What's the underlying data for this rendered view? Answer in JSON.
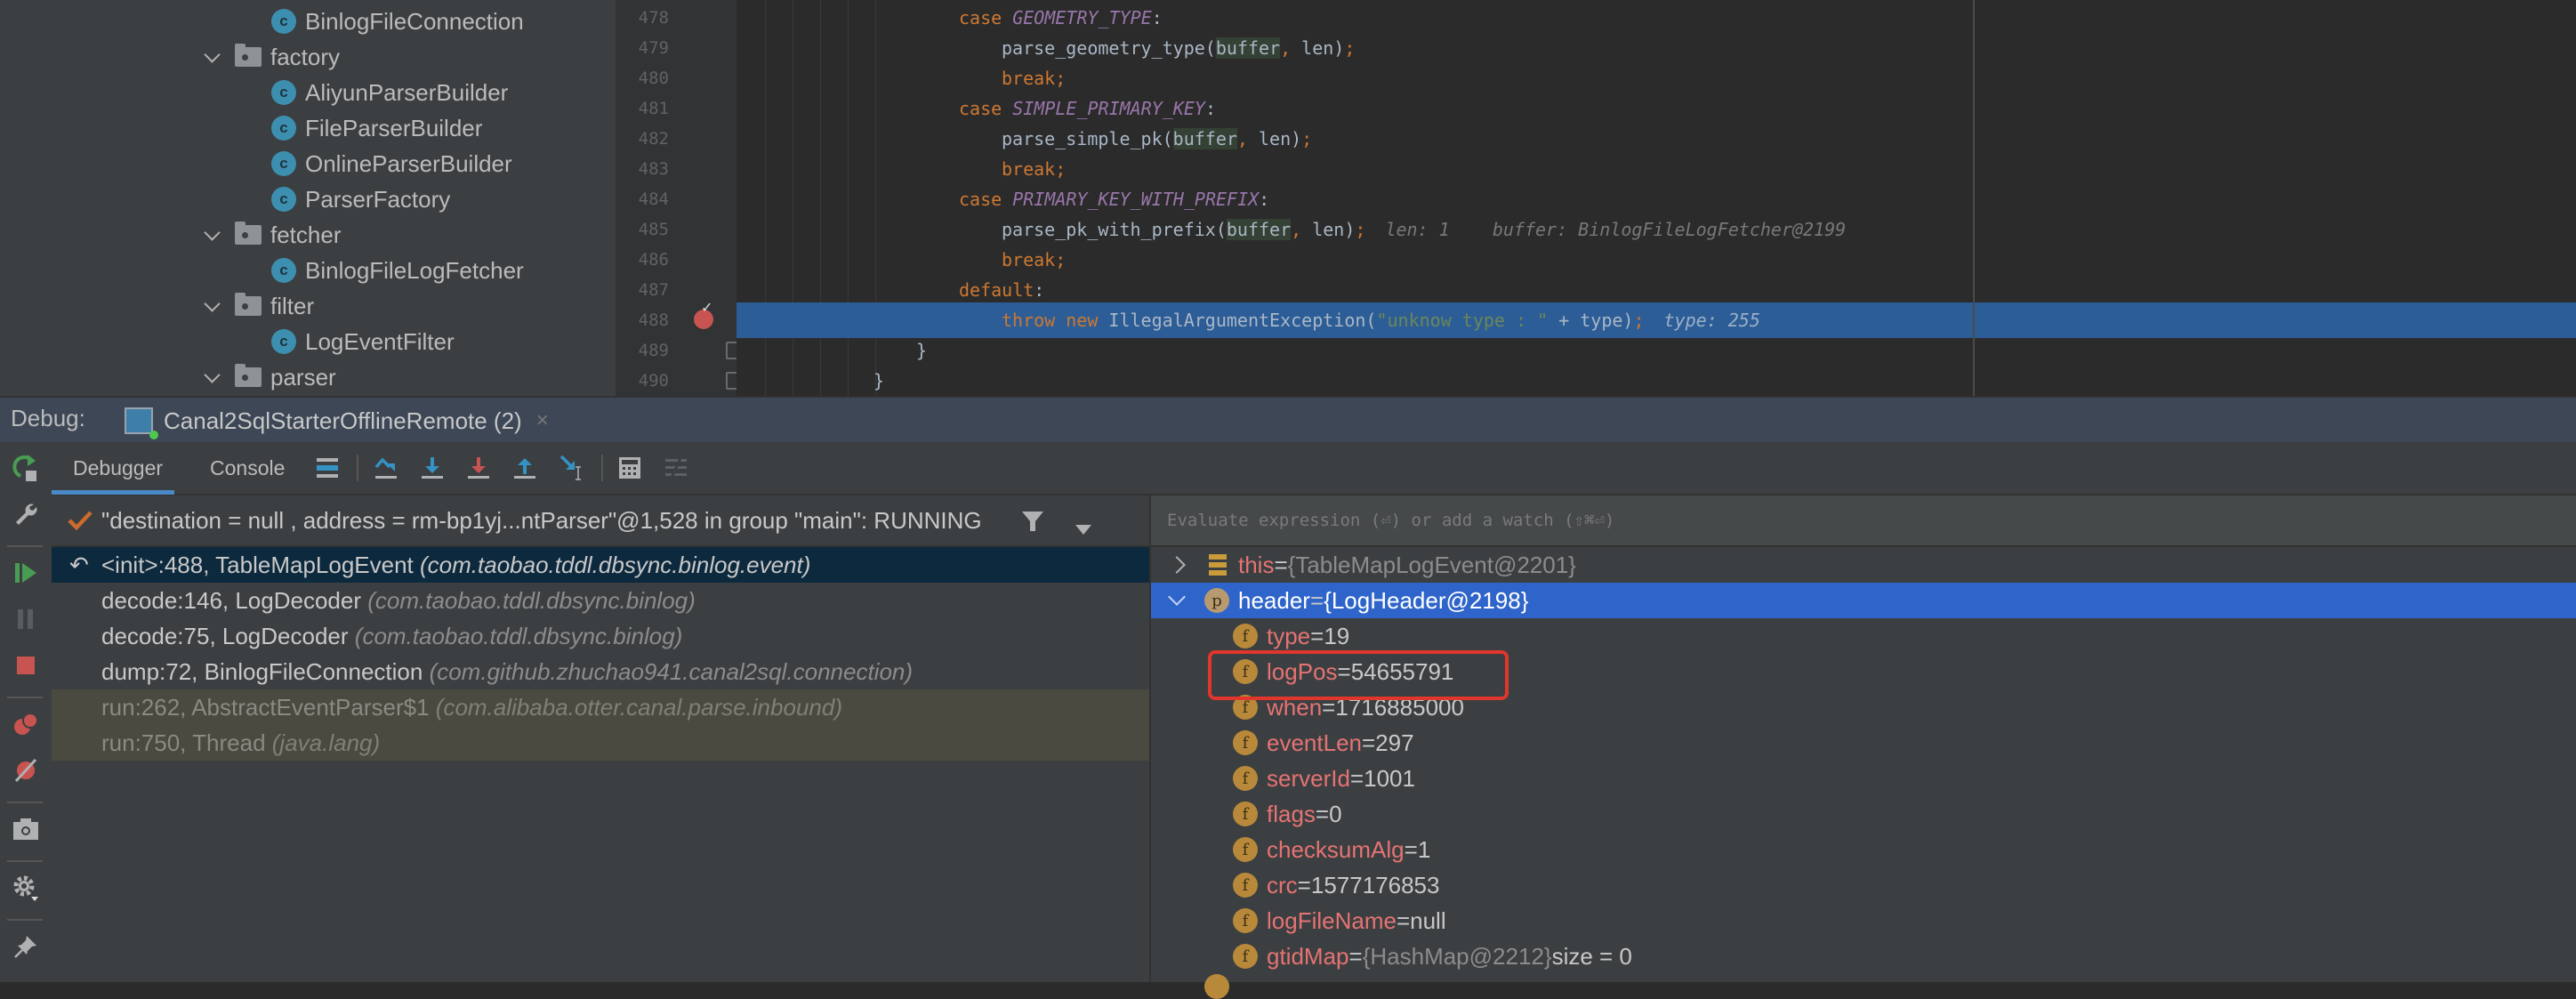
{
  "project_tree": {
    "items": [
      {
        "type": "class",
        "label": "BinlogFileConnection",
        "level": 2
      },
      {
        "type": "folder",
        "label": "factory",
        "level": 1,
        "expanded": true
      },
      {
        "type": "class",
        "label": "AliyunParserBuilder",
        "level": 2
      },
      {
        "type": "class",
        "label": "FileParserBuilder",
        "level": 2
      },
      {
        "type": "class",
        "label": "OnlineParserBuilder",
        "level": 2
      },
      {
        "type": "class",
        "label": "ParserFactory",
        "level": 2
      },
      {
        "type": "folder",
        "label": "fetcher",
        "level": 1,
        "expanded": true
      },
      {
        "type": "class",
        "label": "BinlogFileLogFetcher",
        "level": 2
      },
      {
        "type": "folder",
        "label": "filter",
        "level": 1,
        "expanded": true
      },
      {
        "type": "class",
        "label": "LogEventFilter",
        "level": 2
      },
      {
        "type": "folder",
        "label": "parser",
        "level": 1,
        "expanded": true
      }
    ],
    "class_icon_letter": "c"
  },
  "editor": {
    "line_numbers": [
      "478",
      "479",
      "480",
      "481",
      "482",
      "483",
      "484",
      "485",
      "486",
      "487",
      "488",
      "489",
      "490"
    ],
    "execution_line": "488",
    "breakpoint_line": "488",
    "lines": {
      "l478": {
        "kw": "case ",
        "const": "GEOMETRY_TYPE",
        "rest": ":"
      },
      "l479": {
        "fn": "parse_geometry_type(",
        "arg": "buffer",
        "comma": ", ",
        "rest": "len)",
        "semi": ";"
      },
      "l480": {
        "kw": "break;"
      },
      "l481": {
        "kw": "case ",
        "const": "SIMPLE_PRIMARY_KEY",
        "rest": ":"
      },
      "l482": {
        "fn": "parse_simple_pk(",
        "arg": "buffer",
        "comma": ", ",
        "rest": "len)",
        "semi": ";"
      },
      "l483": {
        "kw": "break;"
      },
      "l484": {
        "kw": "case ",
        "const": "PRIMARY_KEY_WITH_PREFIX",
        "rest": ":"
      },
      "l485": {
        "fn": "parse_pk_with_prefix(",
        "arg": "buffer",
        "comma": ", ",
        "rest": "len)",
        "semi": ";",
        "hint": "len: 1    buffer: BinlogFileLogFetcher@2199"
      },
      "l486": {
        "kw": "break;"
      },
      "l487": {
        "kw": "default",
        "rest": ":"
      },
      "l488": {
        "kw": "throw new ",
        "fn": "IllegalArgumentException(",
        "str": "\"unknow type : \"",
        "rest": " + type)",
        "semi": ";",
        "hint": "type: 255"
      },
      "l489": {
        "rest": "}"
      },
      "l490": {
        "rest": "}"
      }
    }
  },
  "debug": {
    "label": "Debug:",
    "session_tab": "Canal2SqlStarterOfflineRemote (2)",
    "session_close": "×",
    "tabs": [
      {
        "label": "Debugger",
        "active": true
      },
      {
        "label": "Console",
        "active": false
      }
    ],
    "toolbar_icons": [
      "show-execution-point-icon",
      "step-over-icon",
      "step-into-icon",
      "force-step-into-icon",
      "step-out-icon",
      "run-to-cursor-icon",
      "evaluate-expression-icon",
      "trace-current-stream-icon"
    ],
    "side_icons": [
      "rerun-icon",
      "settings-wrench-icon",
      "resume-icon",
      "pause-icon",
      "stop-icon",
      "view-breakpoints-icon",
      "mute-breakpoints-icon",
      "camera-icon",
      "gear-icon",
      "pin-icon"
    ]
  },
  "frames": {
    "thread": "\"destination = null , address = rm-bp1yj...ntParser\"@1,528 in group \"main\": RUNNING",
    "items": [
      {
        "method": "<init>:488, TableMapLogEvent ",
        "pkg": "(com.taobao.tddl.dbsync.binlog.event)",
        "state": "selected"
      },
      {
        "method": "decode:146, LogDecoder ",
        "pkg": "(com.taobao.tddl.dbsync.binlog)",
        "state": "normal"
      },
      {
        "method": "decode:75, LogDecoder ",
        "pkg": "(com.taobao.tddl.dbsync.binlog)",
        "state": "normal"
      },
      {
        "method": "dump:72, BinlogFileConnection ",
        "pkg": "(com.github.zhuchao941.canal2sql.connection)",
        "state": "normal"
      },
      {
        "method": "run:262, AbstractEventParser$1 ",
        "pkg": "(com.alibaba.otter.canal.parse.inbound)",
        "state": "library"
      },
      {
        "method": "run:750, Thread ",
        "pkg": "(java.lang)",
        "state": "library"
      }
    ]
  },
  "variables": {
    "eval_placeholder": "Evaluate expression (⏎) or add a watch (⇧⌘⏎)",
    "items": [
      {
        "name": "this",
        "eq": " = ",
        "value": "{TableMapLogEvent@2201}",
        "icon": "list-icon",
        "expander": "collapsed",
        "level": 0,
        "value_kind": "object"
      },
      {
        "name": "header",
        "eq": " = ",
        "value": "{LogHeader@2198}",
        "icon": "p",
        "expander": "expanded",
        "level": 0,
        "value_kind": "object",
        "selected": true
      },
      {
        "name": "type",
        "eq": " = ",
        "value": "19",
        "icon": "f",
        "level": 1,
        "value_kind": "primitive"
      },
      {
        "name": "logPos",
        "eq": " = ",
        "value": "54655791",
        "icon": "f",
        "level": 1,
        "value_kind": "primitive",
        "highlighted": true
      },
      {
        "name": "when",
        "eq": " = ",
        "value": "1716885000",
        "icon": "f",
        "level": 1,
        "value_kind": "primitive"
      },
      {
        "name": "eventLen",
        "eq": " = ",
        "value": "297",
        "icon": "f",
        "level": 1,
        "value_kind": "primitive"
      },
      {
        "name": "serverId",
        "eq": " = ",
        "value": "1001",
        "icon": "f",
        "level": 1,
        "value_kind": "primitive"
      },
      {
        "name": "flags",
        "eq": " = ",
        "value": "0",
        "icon": "f",
        "level": 1,
        "value_kind": "primitive"
      },
      {
        "name": "checksumAlg",
        "eq": " = ",
        "value": "1",
        "icon": "f",
        "level": 1,
        "value_kind": "primitive"
      },
      {
        "name": "crc",
        "eq": " = ",
        "value": "1577176853",
        "icon": "f",
        "level": 1,
        "value_kind": "primitive"
      },
      {
        "name": "logFileName",
        "eq": " = ",
        "value": "null",
        "icon": "f",
        "level": 1,
        "value_kind": "primitive"
      },
      {
        "name": "gtidMap",
        "eq": " = ",
        "value": "{HashMap@2212}",
        "extra": "  size = 0",
        "icon": "f",
        "level": 1,
        "value_kind": "object"
      }
    ]
  },
  "colors": {
    "execution_line": "#2d5d96",
    "selected_variable": "#2f65ca",
    "selected_frame": "#0d293e",
    "highlight_box": "#e0362c",
    "breakpoint": "#c75450"
  }
}
